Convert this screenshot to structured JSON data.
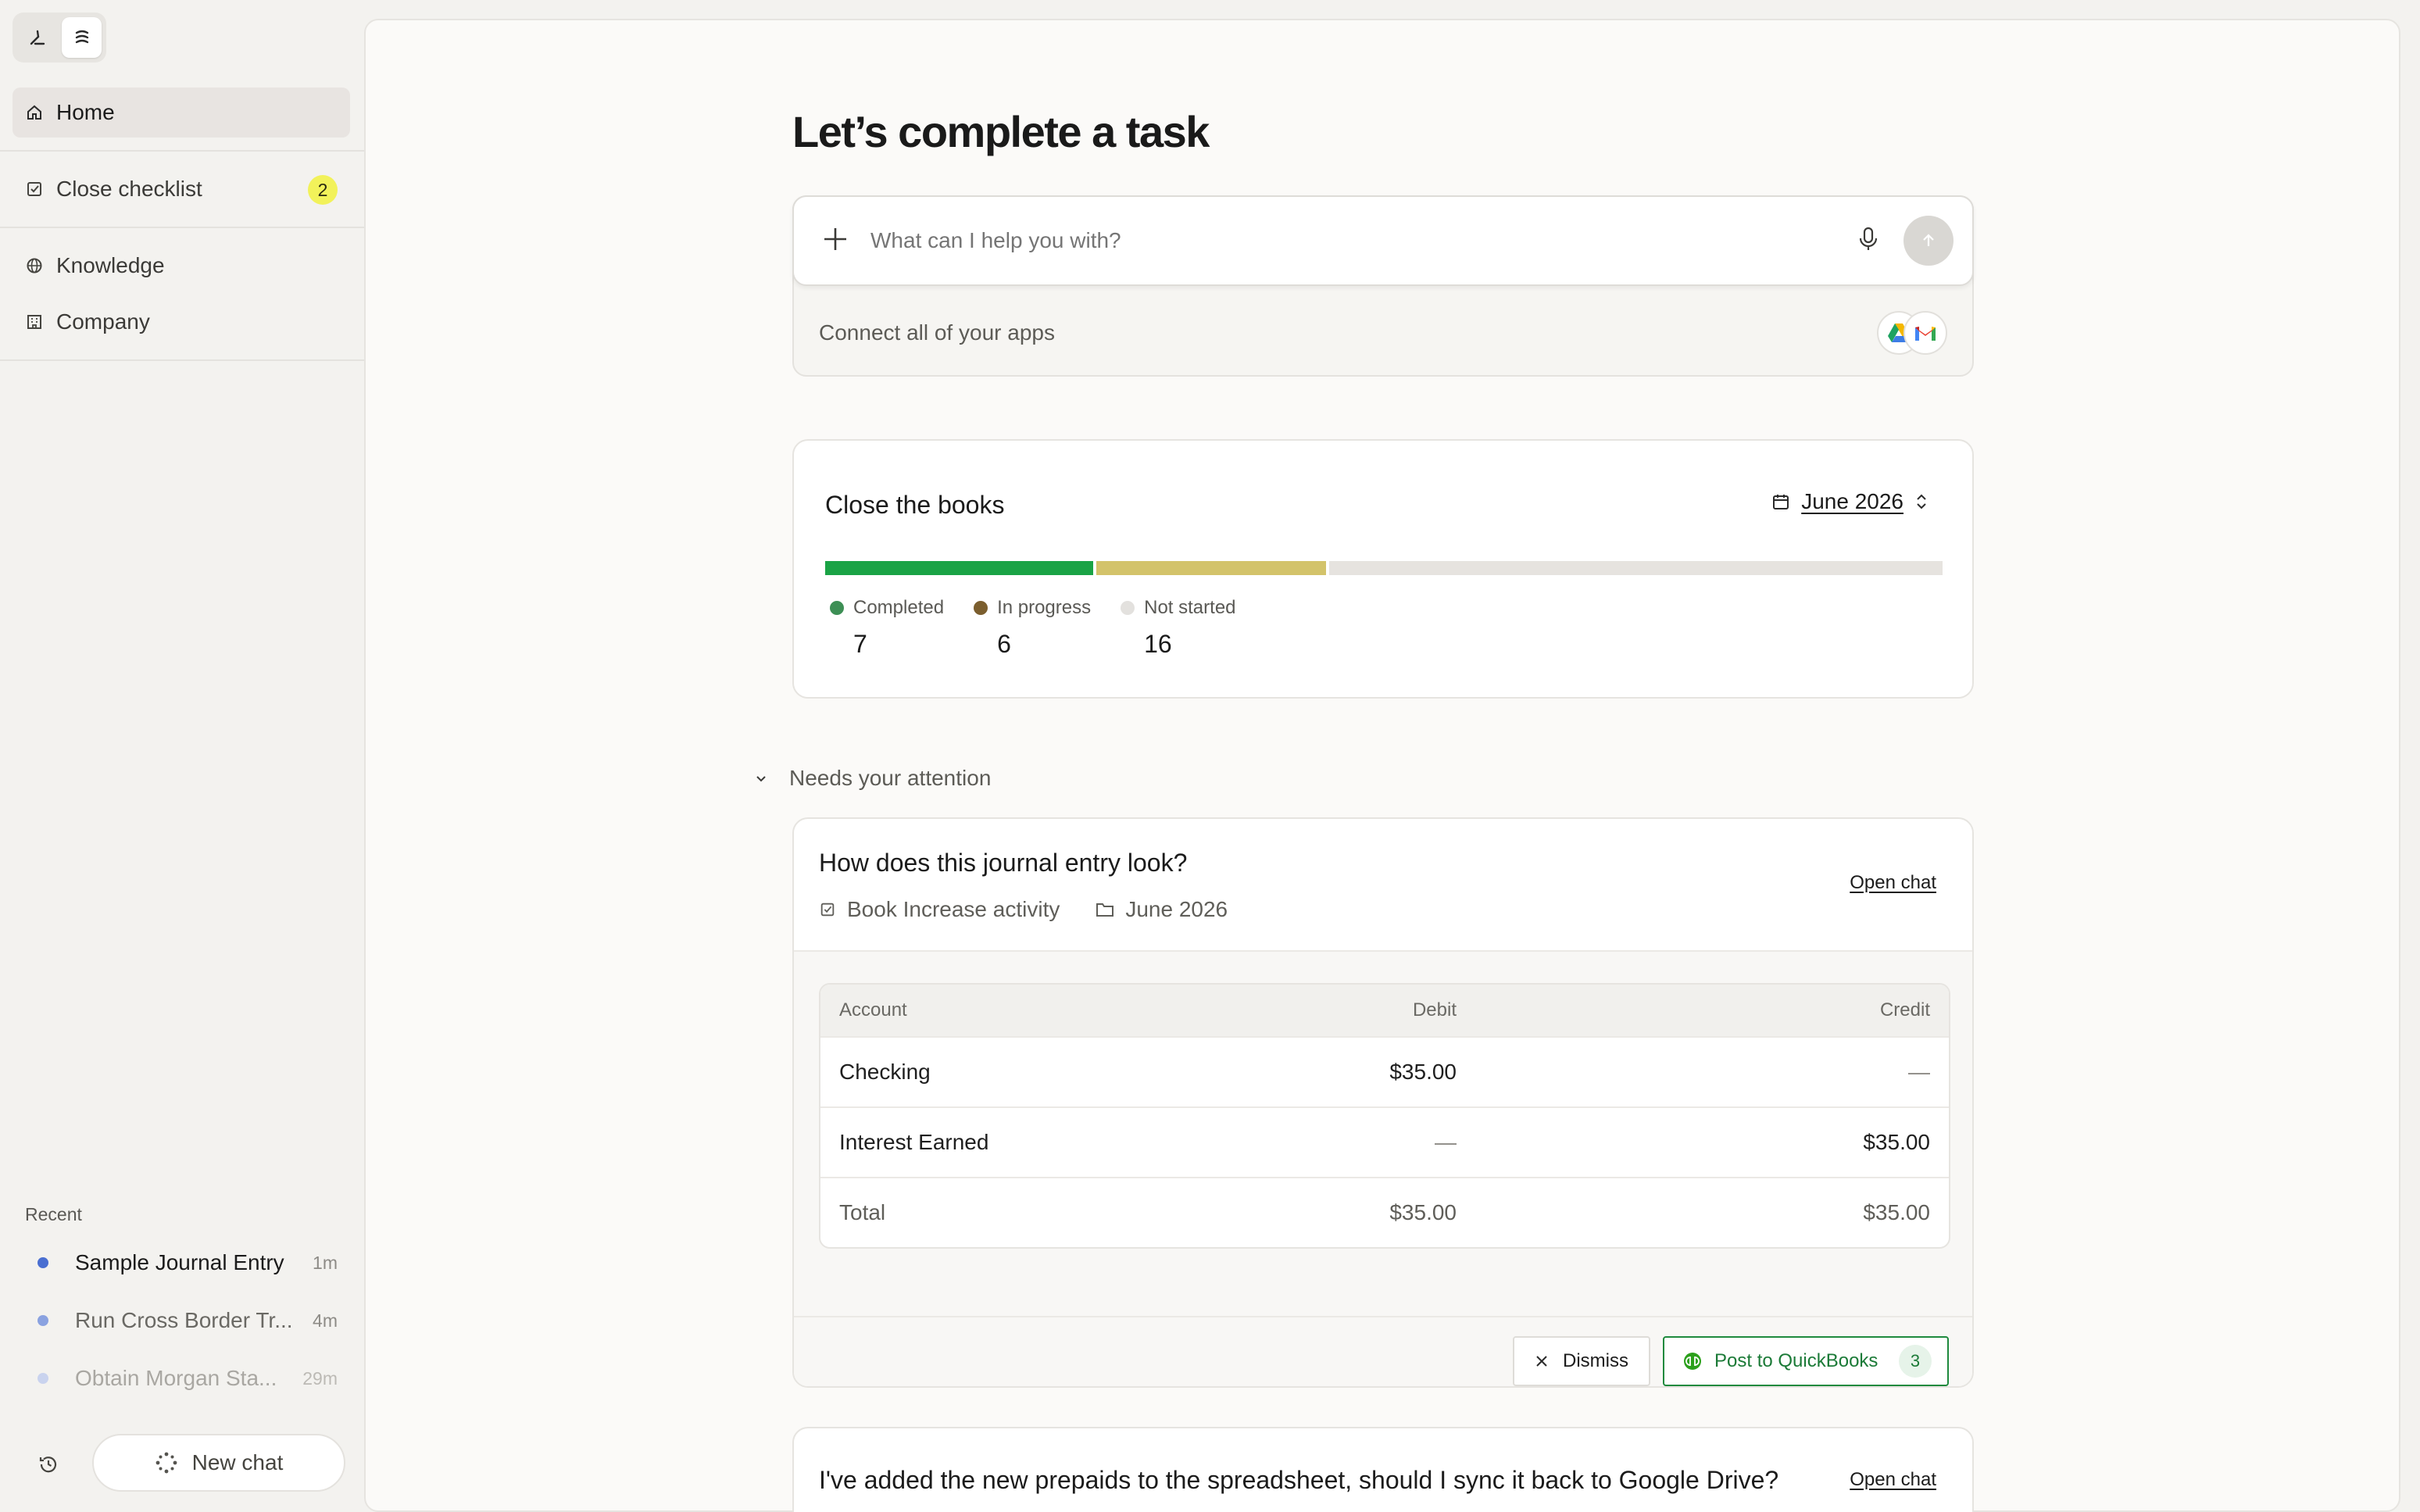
{
  "sidebar": {
    "nav": {
      "home": "Home",
      "close_checklist": "Close checklist",
      "close_checklist_badge": "2",
      "knowledge": "Knowledge",
      "company": "Company"
    },
    "recent_label": "Recent",
    "recent": [
      {
        "title": "Sample Journal Entry",
        "time": "1m",
        "dot_color": "#4a6fd1"
      },
      {
        "title": "Run Cross Border Tr...",
        "time": "4m",
        "dot_color": "#8aa2e0"
      },
      {
        "title": "Obtain Morgan Sta...",
        "time": "29m",
        "dot_color": "#c9d3ee"
      }
    ],
    "new_chat_label": "New chat"
  },
  "main": {
    "title": "Let’s complete a task",
    "prompt": {
      "placeholder": "What can I help you with?"
    },
    "connect_label": "Connect all of your apps",
    "books": {
      "title": "Close the books",
      "period": "June 2026",
      "stats": [
        {
          "label": "Completed",
          "value": 7,
          "color": "#3d8f55"
        },
        {
          "label": "In progress",
          "value": 6,
          "color": "#7b5e2e"
        },
        {
          "label": "Not started",
          "value": 16,
          "color": "#e3e1de"
        }
      ],
      "colors": {
        "completed": "#1aa345",
        "in_progress": "#d3c36a",
        "not_started": "#e6e3df"
      }
    },
    "attention": {
      "heading": "Needs your attention",
      "journal": {
        "title": "How does this journal entry look?",
        "task": "Book Increase activity",
        "folder": "June 2026",
        "open_chat": "Open chat",
        "table": {
          "headers": {
            "account": "Account",
            "debit": "Debit",
            "credit": "Credit"
          },
          "rows": [
            {
              "account": "Checking",
              "debit": "$35.00",
              "credit": "—"
            },
            {
              "account": "Interest Earned",
              "debit": "—",
              "credit": "$35.00"
            }
          ],
          "total": {
            "account": "Total",
            "debit": "$35.00",
            "credit": "$35.00"
          }
        },
        "dismiss": "Dismiss",
        "post": "Post to QuickBooks",
        "post_count": "3"
      },
      "prepaid": {
        "title": "I've added the new prepaids to the spreadsheet, should I sync it back to Google Drive?",
        "open_chat": "Open chat"
      }
    }
  }
}
